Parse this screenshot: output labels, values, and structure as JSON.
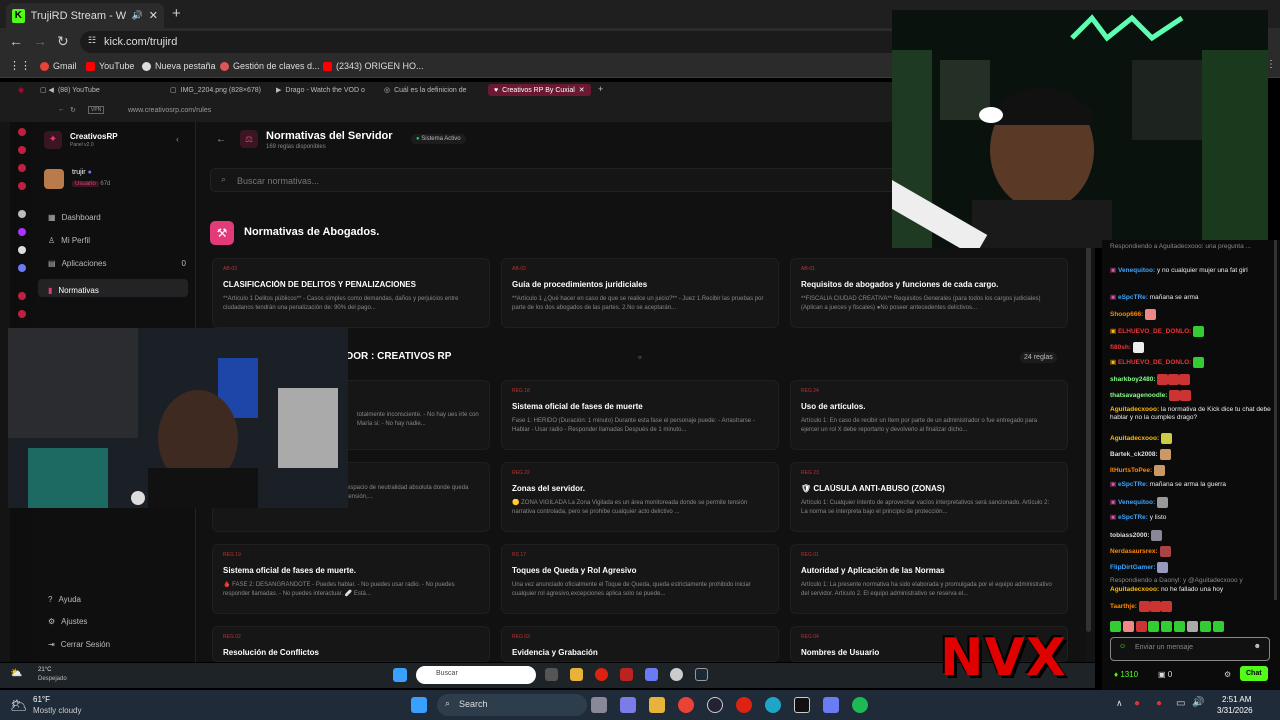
{
  "browser": {
    "tab_title": "TrujiRD Stream - Watch Live",
    "url": "kick.com/trujird",
    "bookmarks": [
      "Gmail",
      "YouTube",
      "Nueva pestaña",
      "Gestión de claves d...",
      "(2343) ORIGEN HO..."
    ]
  },
  "inner_browser": {
    "tabs": [
      "(88) YouTube",
      "IMG_2204.png (828×678)",
      "Drago - Watch the VOD o",
      "Cuál es la definicion de",
      "Creativos RP By Cuxial"
    ],
    "url": "www.creativosrp.com/rules"
  },
  "app": {
    "brand": "CreativosRP",
    "version": "Panel v2.0",
    "user_name": "trujir",
    "user_role": "Usuario",
    "user_days": "67d",
    "nav": [
      {
        "label": "Dashboard",
        "icon": "grid-icon"
      },
      {
        "label": "Mi Perfil",
        "icon": "user-icon"
      },
      {
        "label": "Aplicaciones",
        "icon": "doc-icon",
        "count": "0"
      },
      {
        "label": "Normativas",
        "icon": "book-icon"
      }
    ],
    "bottom_nav": [
      "Ayuda",
      "Ajustes",
      "Cerrar Sesión"
    ],
    "page_title": "Normativas del Servidor",
    "page_subtitle": "169 reglas disponibles",
    "status_badge": "Sistema Activo",
    "search_placeholder": "Buscar normativas...",
    "section1_title": "Normativas de Abogados.",
    "section2_title": "DOR : CREATIVOS RP",
    "section2_count": "24 reglas",
    "cards": [
      {
        "code": "AB-03",
        "title": "CLASIFICACIÓN DE DELITOS Y PENALIZACIONES",
        "desc": "**Artículo 1 Delitos públicos** - Casos simples como demandas, daños y perjuicios entre ciudadanos tendrán una penalización de: 90% del pago..."
      },
      {
        "code": "AB-02",
        "title": "Guía de procedimientos juridiciales",
        "desc": "**Artículo 1 ¿Qué hacer en caso de que se realice un juicio?** - Juez 1.Recibir las pruebas por parte de los dos abogados de las partes. 2.No se aceptarán..."
      },
      {
        "code": "AB-01",
        "title": "Requisitos de abogados y funciones de cada cargo.",
        "desc": "**FISCALIA CIUDAD CREATIVA** Requisitos Generales (para todos los cargos judiciales) (Aplican a jueces y fiscales) ●No poseer antecedentes delictivos..."
      },
      {
        "code": "",
        "title": "e.",
        "desc": "totalmente inconsciente. - No hay ues irte con María si: - No hay nadie..."
      },
      {
        "code": "REG 18",
        "title": "Sistema oficial de fases de muerte",
        "desc": "Fase 1: HERIDO (Duración: 1 minuto) Durante esta fase el personaje puede: - Arrastrarse - Hablar - Usar radio - Responder llamadas Después de 1 minuto..."
      },
      {
        "code": "REG 24",
        "title": "Uso de artículos.",
        "desc": "Artículo 1: En caso de recibir un ítem por parte de un administrador o fue entregado para ejercer un rol X debe reportarlo y devolverlo al finalizar dicho..."
      },
      {
        "code": "",
        "title": "",
        "desc": "🔵 ZONA SEGURA 📌 La Zona Segura es un espacio de neutralidad absoluta donde queda prohibida cualquier acción que pueda generar tensión,..."
      },
      {
        "code": "REG 22",
        "title": "Zonas del servidor.",
        "desc": "🟡 ZONA VIGILADA La Zona Vigilada es un área monitoreada donde se permite tensión narrativa controlada, pero se prohíbe cualquier acto delictivo ..."
      },
      {
        "code": "REG 23",
        "title": "🛡 CLAÚSULA ANTI-ABUSO (ZONAS)",
        "desc": "Artículo 1: Cualquier intento de aprovechar vacíos interpretativos será sancionado. Artículo 2: La norma se interpreta bajo el principio de protección..."
      },
      {
        "code": "REG 19",
        "title": "Sistema oficial de fases de muerte.",
        "desc": "🩸 FASE 2: DESANGRÁNDOTE - Puedes hablar. - No puedes usar radio. - No puedes responder llamadas. - No puedes interactuar. 🩹 Está..."
      },
      {
        "code": "RS 17",
        "title": "Toques de Queda y Rol Agresivo",
        "desc": "Una vez anunciado oficialmente el Toque de Queda, queda estrictamente prohibido iniciar cualquier rol agresivo,excepciones aplica solo se puede..."
      },
      {
        "code": "REG 01",
        "title": "Autoridad y Aplicación de las Normas",
        "desc": "Artículo 1: La presente normativa ha sido elaborada y promulgada por el equipo administrativo del servidor. Artículo 2. El equipo administrativo se reserva el..."
      },
      {
        "code": "REG 02",
        "title": "Resolución de Conflictos",
        "desc": ""
      },
      {
        "code": "REG 03",
        "title": "Evidencia y Grabación",
        "desc": ""
      },
      {
        "code": "REG 04",
        "title": "Nombres de Usuario",
        "desc": ""
      }
    ]
  },
  "chat": {
    "messages": [
      {
        "user": "",
        "text": "Respondiendo a Aguitadecxooo: una pregunta ..."
      },
      {
        "user": "Venequitoo:",
        "text": "y no cualquier mujer una fat girl"
      },
      {
        "user": "eSpcTRe:",
        "text": "mañana se arma"
      },
      {
        "user": "Shoop666:",
        "text": ""
      },
      {
        "user": "ELHUEVO_DE_DONLO:",
        "text": ""
      },
      {
        "user": "fi80sh:",
        "text": ""
      },
      {
        "user": "ELHUEVO_DE_DONLO:",
        "text": ""
      },
      {
        "user": "sharkboy2480:",
        "text": ""
      },
      {
        "user": "thatsavagenoodle:",
        "text": ""
      },
      {
        "user": "Aguitadecxooo:",
        "text": "la normativa de Kick dice tu chat debe hablar y no la cumples drago?"
      },
      {
        "user": "Aguitadecxooo:",
        "text": ""
      },
      {
        "user": "Bartek_ck2008:",
        "text": ""
      },
      {
        "user": "ItHurtsToPee:",
        "text": ""
      },
      {
        "user": "eSpcTRe:",
        "text": "mañana se arma la guerra"
      },
      {
        "user": "Venequitoo:",
        "text": ""
      },
      {
        "user": "eSpcTRe:",
        "text": "y listo"
      },
      {
        "user": "tobiass2000:",
        "text": ""
      },
      {
        "user": "Nerdasaursrex:",
        "text": ""
      },
      {
        "user": "FlipDirtGamer:",
        "text": ""
      },
      {
        "user": "",
        "text": "Respondiendo a Daonyl: y @Aguitadecxooo y"
      },
      {
        "user": "Aguitadecxooo:",
        "text": "no he fallado una hoy"
      },
      {
        "user": "Taarthje:",
        "text": ""
      }
    ],
    "input_placeholder": "Enviar un mensaje",
    "viewer_count": "1310",
    "points": "0",
    "chat_button": "Chat"
  },
  "inner_taskbar": {
    "temp": "21°C",
    "weather": "Despejado",
    "search": "Buscar"
  },
  "taskbar": {
    "temp": "61°F",
    "weather": "Mostly cloudy",
    "search": "Search",
    "time": "2:51 AM",
    "date": "3/31/2026"
  },
  "overlay_logo": "NVX",
  "colors": {
    "accent_pink": "#e33b7a",
    "kick_green": "#53fc18",
    "chat_user": "#3aa5ff"
  }
}
